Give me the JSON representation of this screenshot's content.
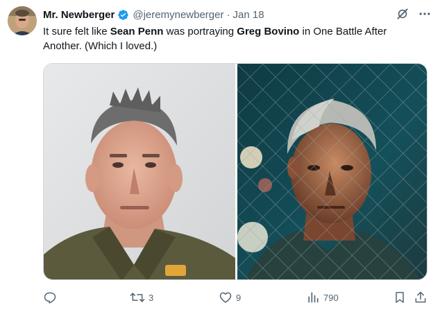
{
  "author": {
    "display_name": "Mr. Newberger",
    "handle": "@jeremynewberger",
    "separator": "·",
    "time": "Jan 18",
    "verified": true
  },
  "tweet": {
    "text_part1": "It sure felt like ",
    "bold1": "Sean Penn",
    "text_part2": " was portraying ",
    "bold2": "Greg Bovino",
    "text_part3": " in One Battle After Another. (Which I loved.)"
  },
  "media": {
    "images": [
      {
        "subject": "uniformed-officer-portrait"
      },
      {
        "subject": "actor-behind-fence-still"
      }
    ]
  },
  "actions": {
    "reply_count": "",
    "retweet_count": "3",
    "like_count": "9",
    "views_count": "790"
  },
  "icons": [
    "grok-icon",
    "more-icon",
    "verified-badge-icon",
    "reply-icon",
    "retweet-icon",
    "like-icon",
    "views-icon",
    "bookmark-icon",
    "share-icon"
  ],
  "colors": {
    "text": "#0f1419",
    "secondary": "#536471",
    "verified": "#1d9bf0",
    "border": "#cfd9de"
  }
}
